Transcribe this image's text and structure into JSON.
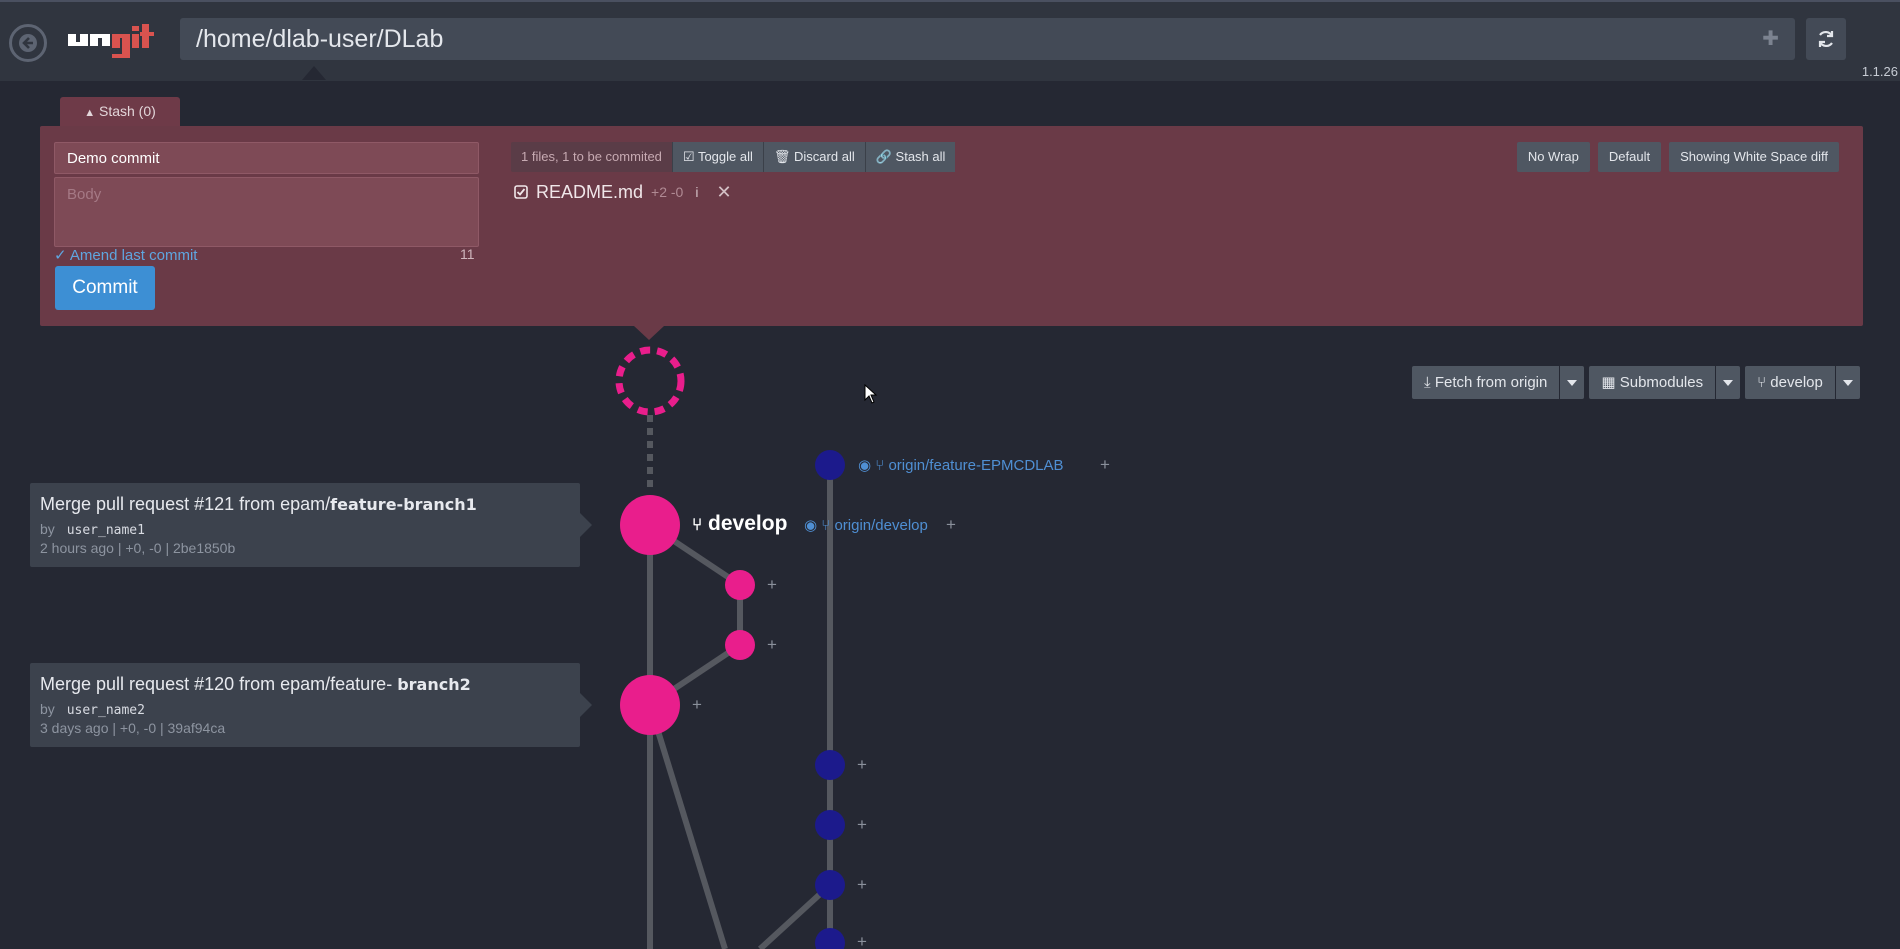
{
  "app": {
    "logo_text": "ungit",
    "path": "/home/dlab-user/DLab",
    "version": "1.1.26"
  },
  "stash": {
    "label": "Stash (0)"
  },
  "commit_form": {
    "title_value": "Demo commit",
    "body_placeholder": "Body",
    "amend_label": "✓ Amend last commit",
    "char_count": "11",
    "commit_label": "Commit"
  },
  "files": {
    "summary": "1 files, 1 to be commited",
    "toggle_all": "Toggle all",
    "discard_all": "Discard all",
    "stash_all": "Stash all",
    "items": [
      {
        "name": "README.md",
        "diff": "+2 -0",
        "info": "i",
        "remove": "✕"
      }
    ]
  },
  "diff_options": {
    "wrap": "No Wrap",
    "default": "Default",
    "whitespace": "Showing White Space diff"
  },
  "graph_actions": {
    "fetch": "Fetch from origin",
    "submodules": "Submodules",
    "branch": "develop"
  },
  "commits": [
    {
      "title_prefix": "Merge pull request #121 from epam/",
      "title_branch": "feature-branch1",
      "by": "by",
      "author": "user_name1",
      "meta": "2 hours ago | +0, -0 | 2be1850b"
    },
    {
      "title_prefix": "Merge pull request #120 from epam/feature- ",
      "title_branch": "branch2",
      "by": "by",
      "author": "user_name2",
      "meta": "3 days ago | +0, -0 | 39af94ca"
    }
  ],
  "refs": {
    "remote_feature": "origin/feature-EPMCDLAB",
    "local_develop": "develop",
    "remote_develop": "origin/develop"
  },
  "colors": {
    "background": "#252833",
    "staging_panel": "#6a3a47",
    "accent_blue": "#3d8fd4",
    "branch_pink": "#e91e8c",
    "branch_navy": "#1c1a8c",
    "edge_gray": "#55585f",
    "ref_link": "#4f8fd3"
  },
  "icons": [
    "back-icon",
    "refresh-icon",
    "chevron-up-icon",
    "check-square-icon",
    "trash-icon",
    "link-icon",
    "download-icon",
    "grid-icon",
    "branch-icon",
    "remote-icon",
    "plus-icon",
    "caret-down-icon"
  ]
}
